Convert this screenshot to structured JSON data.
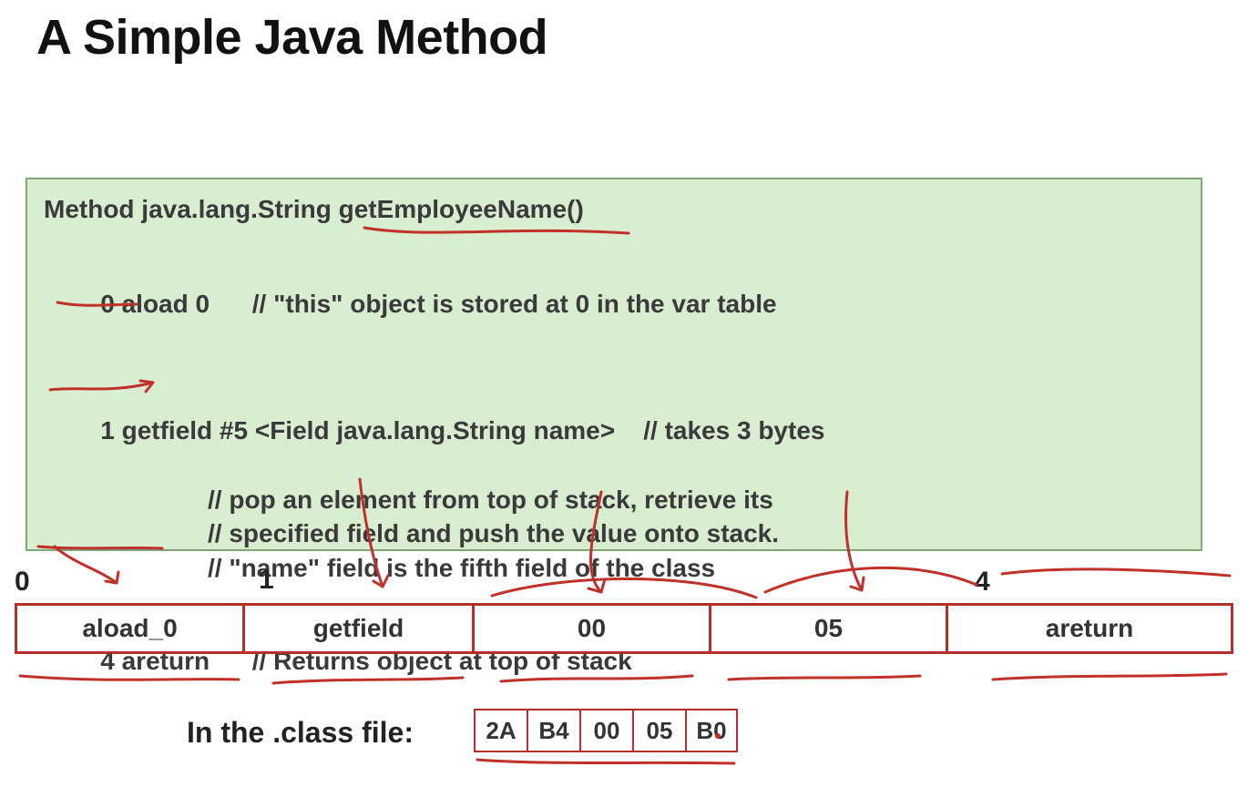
{
  "title": "A Simple Java Method",
  "code": {
    "signature": "Method java.lang.String getEmployeeName()",
    "lines": [
      {
        "pc": "0",
        "op": "aload 0",
        "comment": "// \"this\" object is stored at 0 in the var table"
      },
      {
        "pc": "1",
        "op": "getfield #5 <Field java.lang.String name>",
        "comment": "// takes 3 bytes",
        "extra_comments": [
          "// pop an element from top of stack, retrieve its",
          "// specified field and push the value onto stack.",
          "// \"name\" field is the fifth field of the class"
        ]
      },
      {
        "pc": "4",
        "op": "areturn",
        "comment": "// Returns object at top of stack"
      }
    ]
  },
  "byte_indices": {
    "i0": "0",
    "i1": "1",
    "i4": "4"
  },
  "bytecode_strip": [
    "aload_0",
    "getfield",
    "00",
    "05",
    "areturn"
  ],
  "classfile_label": "In the .class file:",
  "classfile_hex": [
    "2A",
    "B4",
    "00",
    "05",
    "B0"
  ],
  "colors": {
    "codebox_bg": "#d9edd0",
    "codebox_border": "#7fa77a",
    "cell_border": "#b23029",
    "annotation_stroke": "#c0312a"
  }
}
